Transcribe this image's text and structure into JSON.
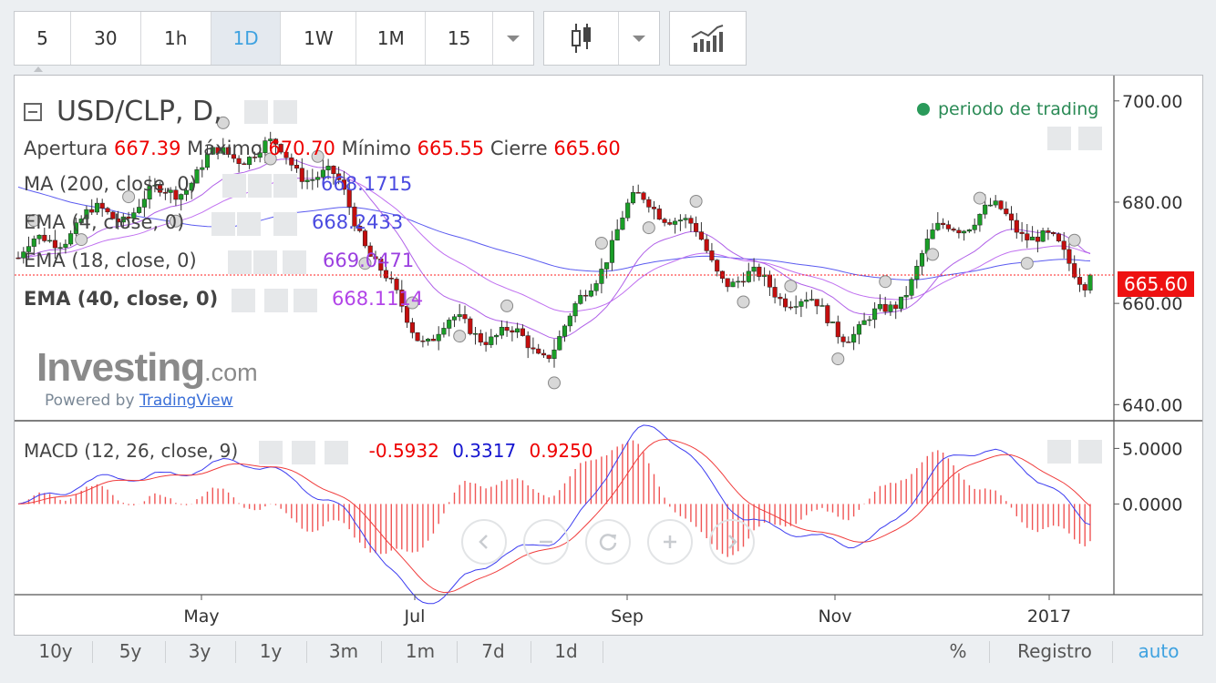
{
  "toolbar": {
    "intervals": [
      {
        "label": "5",
        "active": false
      },
      {
        "label": "30",
        "active": false
      },
      {
        "label": "1h",
        "active": false
      },
      {
        "label": "1D",
        "active": true
      },
      {
        "label": "1W",
        "active": false
      },
      {
        "label": "1M",
        "active": false
      },
      {
        "label": "15",
        "active": false
      }
    ],
    "chart_type_icon": "candlestick-icon",
    "indicators_icon": "indicators-icon"
  },
  "legend": {
    "symbol": "USD/CLP, D,",
    "ohlc": {
      "open_label": "Apertura",
      "open": "667.39",
      "high_label": "Máximo",
      "high": "670.70",
      "low_label": "Mínimo",
      "low": "665.55",
      "close_label": "Cierre",
      "close": "665.60"
    },
    "ma200": {
      "label": "MA (200, close, 0)",
      "value": "668.1715",
      "color": "#4a4ae0"
    },
    "ema4": {
      "label": "EMA (4, close, 0)",
      "value": "668.2433",
      "color": "#4a4ae0"
    },
    "ema18": {
      "label": "EMA (18, close, 0)",
      "value": "669.0471",
      "color": "#9b3fe0"
    },
    "ema40": {
      "label": "EMA (40, close, 0)",
      "value": "668.1114",
      "color": "#b244e8"
    },
    "trading_period": "periodo de trading"
  },
  "watermark": {
    "brand": "Investing",
    "brand_suffix": ".com",
    "powered_by": "Powered by",
    "provider": "TradingView"
  },
  "macd": {
    "label": "MACD (12, 26, close, 9)",
    "hist": "-0.5932",
    "macd": "0.3317",
    "signal": "0.9250"
  },
  "nav_icons": [
    "chevron-left-icon",
    "minus-icon",
    "reset-icon",
    "plus-icon",
    "chevron-right-icon"
  ],
  "price_tag": "665.60",
  "bottom_bar": {
    "ranges": [
      "10y",
      "5y",
      "3y",
      "1y",
      "3m",
      "1m",
      "7d",
      "1d"
    ],
    "percent": "%",
    "log": "Registro",
    "auto": "auto"
  },
  "colors": {
    "up": "#1a9e27",
    "down": "#c40e0e",
    "ma200": "#5b5bf0",
    "ema4": "#4a4ae0",
    "ema18": "#b060e8",
    "ema40": "#c070f0",
    "macd_line": "#3c3cf0",
    "signal_line": "#f03c3c",
    "price_line": "#ff0000",
    "tag_bg": "#ee1111"
  },
  "chart_data": {
    "type": "candlestick",
    "symbol": "USD/CLP",
    "interval": "D",
    "x_ticks": [
      "May",
      "Jul",
      "Sep",
      "Nov",
      "2017"
    ],
    "y_ticks": [
      "700.00",
      "680.00",
      "660.00",
      "640.00"
    ],
    "y_range": [
      637,
      705
    ],
    "last_close": 665.6,
    "series": [
      {
        "name": "USD/CLP",
        "monthly_closes": {
          "Apr": 669,
          "May": 688,
          "Jun": 686,
          "Jul": 652,
          "Aug": 654,
          "Sep": 677,
          "Oct": 667,
          "Nov": 652,
          "Dec": 679,
          "Jan": 665.6
        },
        "extremes": {
          "high": 702,
          "high_month": "May",
          "low": 642,
          "low_month": "Aug"
        }
      },
      {
        "name": "MA (200, close, 0)",
        "last": 668.1715
      },
      {
        "name": "EMA (4, close, 0)",
        "last": 668.2433
      },
      {
        "name": "EMA (18, close, 0)",
        "last": 669.0471
      },
      {
        "name": "EMA (40, close, 0)",
        "last": 668.1114
      }
    ],
    "macd_panel": {
      "y_ticks": [
        "5.0000",
        "0.0000"
      ],
      "y_range": [
        -8,
        7
      ],
      "histogram_last": -0.5932,
      "macd_last": 0.3317,
      "signal_last": 0.925
    }
  }
}
